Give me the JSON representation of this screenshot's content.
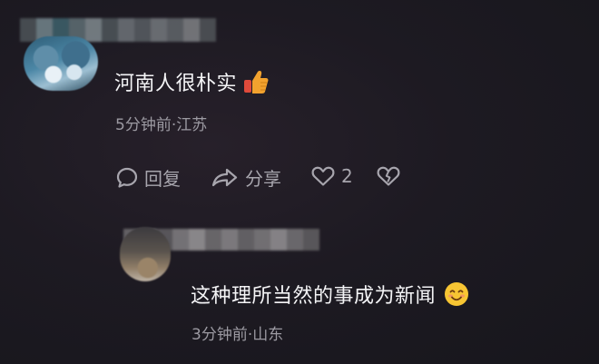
{
  "comment": {
    "text": "河南人很朴实",
    "reaction_emoji": "thumbs-up-icon",
    "meta": "5分钟前·江苏",
    "actions": {
      "reply_label": "回复",
      "share_label": "分享",
      "like_count": "2"
    }
  },
  "reply": {
    "text": "这种理所当然的事成为新闻",
    "reaction_emoji": "smiling-face-icon",
    "meta": "3分钟前·山东"
  },
  "colors": {
    "background": "#1d1a22",
    "text_primary": "#f4f4f6",
    "text_secondary": "#9c9aa2",
    "thumb": "#f0a02a",
    "thumb_cuff": "#e04a3b"
  }
}
